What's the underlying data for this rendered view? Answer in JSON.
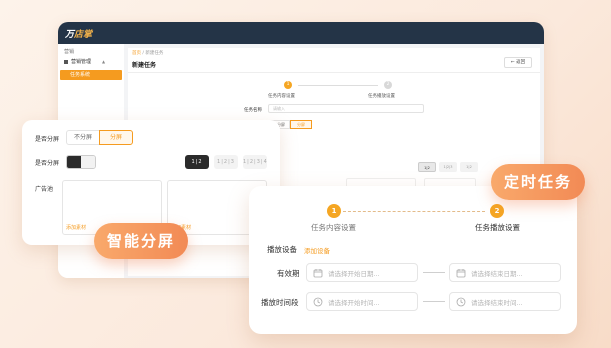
{
  "app": {
    "logo": "万店掌",
    "logo_prefix": "万",
    "logo_suffix": "店掌",
    "sidebar": {
      "group": "营销",
      "menu": "营销管理",
      "active": "任务系统"
    },
    "breadcrumb_home": "首页",
    "breadcrumb_rest": " / 新建任务",
    "title": "新建任务",
    "back_label": "← 返回",
    "steps": [
      {
        "num": "1",
        "label": "任务内容设置"
      },
      {
        "num": "2",
        "label": "任务播放设置"
      }
    ],
    "name_label": "任务名称",
    "name_placeholder": "请输入",
    "split_options": [
      "不分屏",
      "分屏"
    ]
  },
  "left_card": {
    "split_label": "是否分屏",
    "split_options": [
      "不分屏",
      "分屏"
    ],
    "split_selected": "分屏",
    "method_label": "是否分屏",
    "layouts": [
      "1|2",
      "1|2|3",
      "1|2|3|4"
    ],
    "ad_label": "广告池",
    "add_link": "添加素材",
    "add_link_2": "添加素材"
  },
  "right_card": {
    "steps": [
      {
        "num": "1",
        "label": "任务内容设置"
      },
      {
        "num": "2",
        "label": "任务播放设置"
      }
    ],
    "device_label": "播放设备",
    "device_link": "添加设备",
    "validity_label": "有效期",
    "start_date_placeholder": "请选择开始日期...",
    "end_date_placeholder": "请选择结束日期...",
    "period_label": "播放时间段",
    "start_time_placeholder": "请选择开始时间...",
    "end_time_placeholder": "请选择结束时间..."
  },
  "badges": {
    "split_screen": "智能分屏",
    "timed_task": "定时任务"
  },
  "colors": {
    "accent": "#f59b1f",
    "header_dark": "#243447",
    "badge_gradient_start": "#f9a96b",
    "badge_gradient_end": "#f28a55"
  }
}
